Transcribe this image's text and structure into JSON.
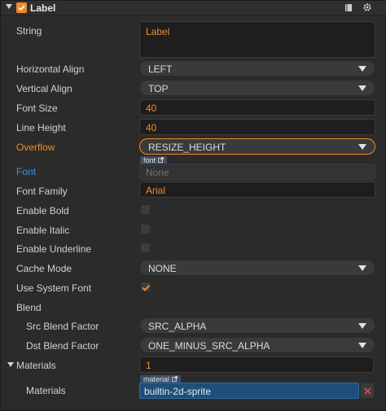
{
  "component": {
    "title": "Label",
    "enabled": true
  },
  "props": {
    "string": {
      "label": "String",
      "value": "Label"
    },
    "horizontal_align": {
      "label": "Horizontal Align",
      "value": "LEFT"
    },
    "vertical_align": {
      "label": "Vertical Align",
      "value": "TOP"
    },
    "font_size": {
      "label": "Font Size",
      "value": "40"
    },
    "line_height": {
      "label": "Line Height",
      "value": "40"
    },
    "overflow": {
      "label": "Overflow",
      "value": "RESIZE_HEIGHT"
    },
    "font": {
      "label": "Font",
      "tag": "font",
      "value": "None"
    },
    "font_family": {
      "label": "Font Family",
      "value": "Arial"
    },
    "enable_bold": {
      "label": "Enable Bold",
      "checked": false
    },
    "enable_italic": {
      "label": "Enable Italic",
      "checked": false
    },
    "enable_underline": {
      "label": "Enable Underline",
      "checked": false
    },
    "cache_mode": {
      "label": "Cache Mode",
      "value": "NONE"
    },
    "use_system_font": {
      "label": "Use System Font",
      "checked": true
    },
    "blend": {
      "label": "Blend"
    },
    "src_blend_factor": {
      "label": "Src Blend Factor",
      "value": "SRC_ALPHA"
    },
    "dst_blend_factor": {
      "label": "Dst Blend Factor",
      "value": "ONE_MINUS_SRC_ALPHA"
    },
    "materials": {
      "label": "Materials",
      "count": "1"
    },
    "materials_item": {
      "label": "Materials",
      "tag": "material",
      "value": "builtin-2d-sprite"
    }
  },
  "colors": {
    "accent": "#f08a24",
    "label_blue": "#3a93e2",
    "asset_bg": "#1e4f7a",
    "remove": "#e04848"
  },
  "icons": {
    "header_book": "book-icon",
    "header_gear": "gear-icon",
    "asset_link": "external-link-icon",
    "remove": "close-icon"
  }
}
